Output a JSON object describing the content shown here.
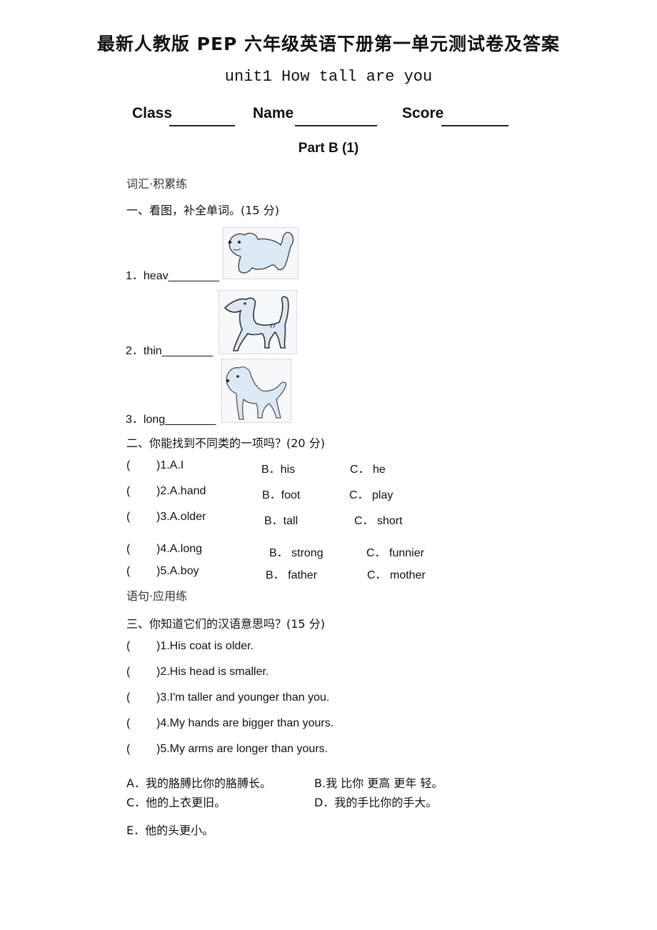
{
  "document": {
    "title": "最新人教版 PEP 六年级英语下册第一单元测试卷及答案",
    "subtitle": "unit1 How tall are you",
    "fields": [
      {
        "label": "Class"
      },
      {
        "label": "Name"
      },
      {
        "label": "Score"
      }
    ],
    "part_title": "Part B (1)"
  },
  "vocab_category": "词汇·积累练",
  "section1": {
    "heading": "一、看图，补全单词。(15 分)",
    "items": [
      {
        "text": "1．heav________",
        "image": "chubby-dog-picture"
      },
      {
        "text": "2．thin________",
        "image": "thin-dog-picture"
      },
      {
        "text": "3．long________",
        "image": "long-haired-dog-picture"
      }
    ]
  },
  "section2": {
    "heading": "二、你能找到不同类的一项吗？(20 分)",
    "items": [
      {
        "paren": "(",
        "a": ")1.A.I",
        "b": "B．his",
        "c": "C． he"
      },
      {
        "paren": "(",
        "a": ")2.A.hand",
        "b": "B．foot",
        "c": "C． play"
      },
      {
        "paren": "(",
        "a": ")3.A.older",
        "b": "B．tall",
        "c": "C． short"
      },
      {
        "paren": "(",
        "a": ")4.A.long",
        "b": "B． strong",
        "c": "C． funnier"
      },
      {
        "paren": "(",
        "a": ")5.A.boy",
        "b": "B． father",
        "c": "C． mother"
      }
    ]
  },
  "sentence_category": "语句·应用练",
  "section3": {
    "heading": "三、你知道它们的汉语意思吗？(15 分)",
    "items": [
      {
        "paren": "(",
        "text": ")1.His coat is older."
      },
      {
        "paren": "(",
        "text": ")2.His head is smaller."
      },
      {
        "paren": "(",
        "text": ")3.I'm taller and younger than you."
      },
      {
        "paren": "(",
        "text": ")4.My hands are bigger than yours."
      },
      {
        "paren": "(",
        "text": ")5.My arms are longer than yours."
      }
    ],
    "options": [
      {
        "text": "A．我的胳膊比你的胳膊长。"
      },
      {
        "text": "B.我 比你 更高 更年 轻。"
      },
      {
        "text": "C．他的上衣更旧。"
      },
      {
        "text": "D．我的手比你的手大。"
      },
      {
        "text": "E．他的头更小。"
      }
    ]
  }
}
